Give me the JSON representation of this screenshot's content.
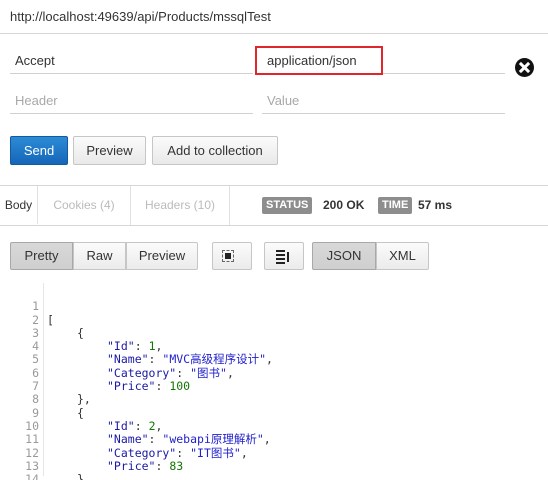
{
  "request": {
    "url": "http://localhost:49639/api/Products/mssqlTest",
    "headers": [
      {
        "key": "Accept",
        "value": "application/json"
      }
    ],
    "new_header": {
      "key_placeholder": "Header",
      "value_placeholder": "Value"
    }
  },
  "actions": {
    "send": "Send",
    "preview": "Preview",
    "add_to_collection": "Add to collection"
  },
  "response_tabs": {
    "body": "Body",
    "cookies": "Cookies (4)",
    "headers": "Headers (10)"
  },
  "status": {
    "status_label": "STATUS",
    "status_value": "200 OK",
    "time_label": "TIME",
    "time_value": "57 ms"
  },
  "view_toolbar": {
    "pretty": "Pretty",
    "raw": "Raw",
    "preview": "Preview",
    "json": "JSON",
    "xml": "XML",
    "fullscreen_icon": "fullscreen-icon",
    "wrap_icon": "wrap-lines-icon"
  },
  "response_body": {
    "line_numbers": [
      "1",
      "2",
      "3",
      "4",
      "5",
      "6",
      "7",
      "8",
      "9",
      "10",
      "11",
      "12",
      "13",
      "14"
    ],
    "products": [
      {
        "id_key": "\"Id\"",
        "id": "1",
        "name_key": "\"Name\"",
        "name": "\"MVC高级程序设计\"",
        "category_key": "\"Category\"",
        "category": "\"图书\"",
        "price_key": "\"Price\"",
        "price": "100"
      },
      {
        "id_key": "\"Id\"",
        "id": "2",
        "name_key": "\"Name\"",
        "name": "\"webapi原理解析\"",
        "category_key": "\"Category\"",
        "category": "\"IT图书\"",
        "price_key": "\"Price\"",
        "price": "83"
      }
    ],
    "brackets": {
      "open_array": "[",
      "close_array": "]",
      "open_obj": "{",
      "close_obj": "}",
      "close_obj_comma": "},"
    }
  },
  "colors": {
    "send_button": "#1a6fc0",
    "highlight_border": "#e0252b",
    "badge_bg": "#8d8d8d"
  }
}
